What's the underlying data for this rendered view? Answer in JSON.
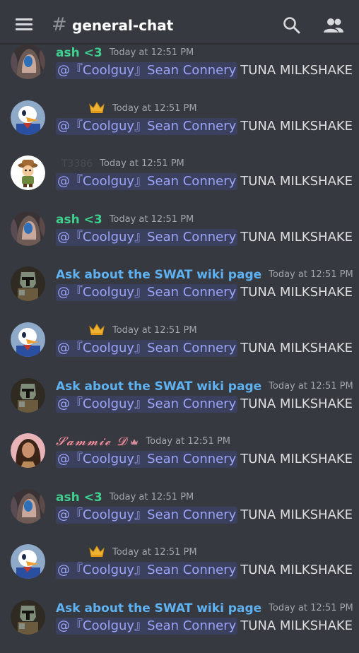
{
  "header": {
    "channel_hash": "#",
    "channel_name": "general-chat",
    "menu_icon": "hamburger-icon",
    "search_icon": "search-icon",
    "members_icon": "members-icon"
  },
  "colors": {
    "background": "#36393f",
    "mention_text": "#9aa4f7",
    "mention_bg": "#3c4270",
    "ash_name": "#3ecf8e",
    "swat_name": "#5fb2f2",
    "sammie_name": "#f28b9b",
    "timestamp": "#a3a6aa",
    "body_text": "#dcddde"
  },
  "messages": [
    {
      "username": "ash <3",
      "timestamp": "Today at 12:51 PM",
      "mention": "@『Coolguy』Sean Connery",
      "text": "TUNA MILKSHAKE",
      "avatar": "ash-avatar"
    },
    {
      "username": "",
      "timestamp": "Today at 12:51 PM",
      "mention": "@『Coolguy』Sean Connery",
      "text": "TUNA MILKSHAKE",
      "avatar": "duck-avatar"
    },
    {
      "username": "T3386",
      "timestamp": "Today at 12:51 PM",
      "mention": "@『Coolguy』Sean Connery",
      "text": "TUNA MILKSHAKE",
      "avatar": "explorer-avatar"
    },
    {
      "username": "ash <3",
      "timestamp": "Today at 12:51 PM",
      "mention": "@『Coolguy』Sean Connery",
      "text": "TUNA MILKSHAKE",
      "avatar": "ash-avatar"
    },
    {
      "username": "Ask about the SWAT wiki page",
      "timestamp": "Today at 12:51 PM",
      "mention": "@『Coolguy』Sean Connery",
      "text": "TUNA MILKSHAKE",
      "avatar": "bounty-hunter-avatar"
    },
    {
      "username": "",
      "timestamp": "Today at 12:51 PM",
      "mention": "@『Coolguy』Sean Connery",
      "text": "TUNA MILKSHAKE",
      "avatar": "duck-avatar"
    },
    {
      "username": "Ask about the SWAT wiki page",
      "timestamp": "Today at 12:51 PM",
      "mention": "@『Coolguy』Sean Connery",
      "text": "TUNA MILKSHAKE",
      "avatar": "bounty-hunter-avatar"
    },
    {
      "username": "𝓢𝓪𝓶𝓶𝓲𝓮 𝓓",
      "timestamp": "Today at 12:51 PM",
      "mention": "@『Coolguy』Sean Connery",
      "text": "TUNA MILKSHAKE",
      "avatar": "sammie-avatar"
    },
    {
      "username": "ash <3",
      "timestamp": "Today at 12:51 PM",
      "mention": "@『Coolguy』Sean Connery",
      "text": "TUNA MILKSHAKE",
      "avatar": "ash-avatar"
    },
    {
      "username": "",
      "timestamp": "Today at 12:51 PM",
      "mention": "@『Coolguy』Sean Connery",
      "text": "TUNA MILKSHAKE",
      "avatar": "duck-avatar"
    },
    {
      "username": "Ask about the SWAT wiki page",
      "timestamp": "Today at 12:51 PM",
      "mention": "@『Coolguy』Sean Connery",
      "text": "TUNA MILKSHAKE",
      "avatar": "bounty-hunter-avatar"
    }
  ]
}
